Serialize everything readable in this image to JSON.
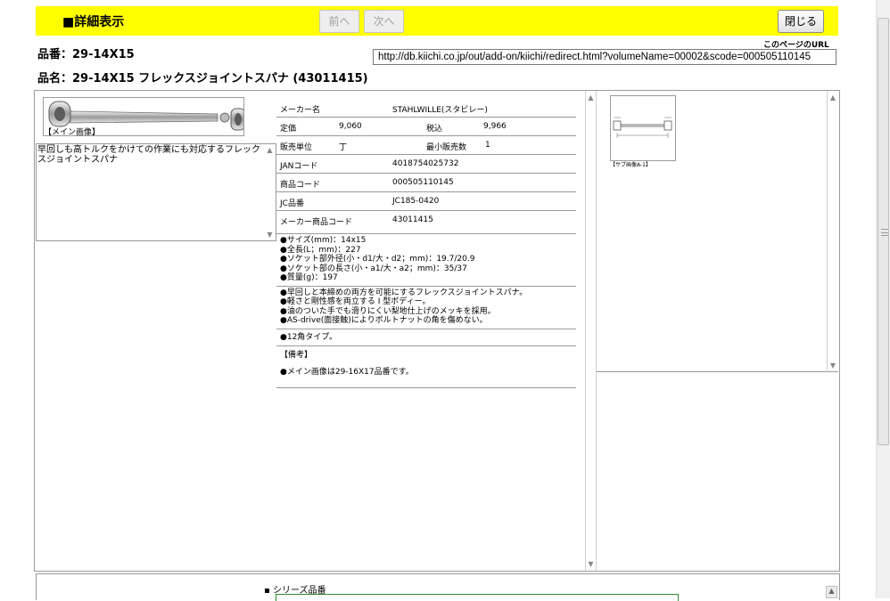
{
  "header": {
    "title": "■詳細表示",
    "prev_label": "前へ",
    "next_label": "次へ",
    "close_label": "閉じる"
  },
  "product": {
    "code_line": "品番：29-14X15",
    "name_line": "品名：29-14X15 フレックスジョイントスパナ (43011415)"
  },
  "url": {
    "label": "このページのURL",
    "value": "http://db.kiichi.co.jp/out/add-on/kiichi/redirect.html?volumeName=00002&scode=000505110145"
  },
  "main_image": {
    "caption": "【メイン画像】"
  },
  "description": "早回しも高トルクをかけての作業にも対応するフレックスジョイントスパナ",
  "specs": {
    "maker_label": "メーカー名",
    "maker_value": "STAHLWILLE(スタビレー)",
    "list_price_label": "定価",
    "list_price_value": "9,060",
    "tax_label": "税込",
    "tax_value": "9,966",
    "unit_label": "販売単位",
    "unit_value": "丁",
    "min_qty_label": "最小販売数",
    "min_qty_value": "1",
    "jan_label": "JANコード",
    "jan_value": "4018754025732",
    "item_code_label": "商品コード",
    "item_code_value": "000505110145",
    "jc_label": "JC品番",
    "jc_value": "JC185-0420",
    "maker_code_label": "メーカー商品コード",
    "maker_code_value": "43011415"
  },
  "notes": {
    "dimensions": [
      "●サイズ(mm)：14x15",
      "●全長(L；mm)：227",
      "●ソケット部外径(小・d1/大・d2；mm)：19.7/20.9",
      "●ソケット部の長さ(小・a1/大・a2；mm)：35/37",
      "●質量(g)：197"
    ],
    "features": [
      "●早回しと本締めの両方を可能にするフレックスジョイントスパナ。",
      "●軽さと剛性感を両立する I 型ボディー。",
      "●油のついた手でも滑りにくい梨地仕上げのメッキを採用。",
      "●AS-drive(面接触)によりボルトナットの角を傷めない。"
    ],
    "type": "●12角タイプ。",
    "remarks_heading": "【備考】",
    "remarks": "●メイン画像は29-16X17品番です。"
  },
  "sub_image": {
    "caption": "【サブ画像A-1】"
  },
  "series": {
    "label": "シリーズ品番"
  }
}
